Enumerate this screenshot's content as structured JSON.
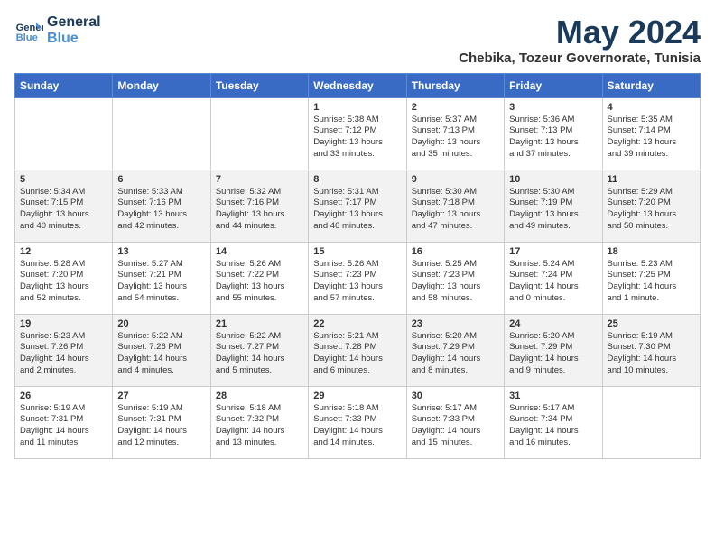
{
  "logo": {
    "line1": "General",
    "line2": "Blue"
  },
  "title": "May 2024",
  "location": "Chebika, Tozeur Governorate, Tunisia",
  "days_header": [
    "Sunday",
    "Monday",
    "Tuesday",
    "Wednesday",
    "Thursday",
    "Friday",
    "Saturday"
  ],
  "weeks": [
    {
      "alt": false,
      "days": [
        {
          "num": "",
          "info": ""
        },
        {
          "num": "",
          "info": ""
        },
        {
          "num": "",
          "info": ""
        },
        {
          "num": "1",
          "info": "Sunrise: 5:38 AM\nSunset: 7:12 PM\nDaylight: 13 hours\nand 33 minutes."
        },
        {
          "num": "2",
          "info": "Sunrise: 5:37 AM\nSunset: 7:13 PM\nDaylight: 13 hours\nand 35 minutes."
        },
        {
          "num": "3",
          "info": "Sunrise: 5:36 AM\nSunset: 7:13 PM\nDaylight: 13 hours\nand 37 minutes."
        },
        {
          "num": "4",
          "info": "Sunrise: 5:35 AM\nSunset: 7:14 PM\nDaylight: 13 hours\nand 39 minutes."
        }
      ]
    },
    {
      "alt": true,
      "days": [
        {
          "num": "5",
          "info": "Sunrise: 5:34 AM\nSunset: 7:15 PM\nDaylight: 13 hours\nand 40 minutes."
        },
        {
          "num": "6",
          "info": "Sunrise: 5:33 AM\nSunset: 7:16 PM\nDaylight: 13 hours\nand 42 minutes."
        },
        {
          "num": "7",
          "info": "Sunrise: 5:32 AM\nSunset: 7:16 PM\nDaylight: 13 hours\nand 44 minutes."
        },
        {
          "num": "8",
          "info": "Sunrise: 5:31 AM\nSunset: 7:17 PM\nDaylight: 13 hours\nand 46 minutes."
        },
        {
          "num": "9",
          "info": "Sunrise: 5:30 AM\nSunset: 7:18 PM\nDaylight: 13 hours\nand 47 minutes."
        },
        {
          "num": "10",
          "info": "Sunrise: 5:30 AM\nSunset: 7:19 PM\nDaylight: 13 hours\nand 49 minutes."
        },
        {
          "num": "11",
          "info": "Sunrise: 5:29 AM\nSunset: 7:20 PM\nDaylight: 13 hours\nand 50 minutes."
        }
      ]
    },
    {
      "alt": false,
      "days": [
        {
          "num": "12",
          "info": "Sunrise: 5:28 AM\nSunset: 7:20 PM\nDaylight: 13 hours\nand 52 minutes."
        },
        {
          "num": "13",
          "info": "Sunrise: 5:27 AM\nSunset: 7:21 PM\nDaylight: 13 hours\nand 54 minutes."
        },
        {
          "num": "14",
          "info": "Sunrise: 5:26 AM\nSunset: 7:22 PM\nDaylight: 13 hours\nand 55 minutes."
        },
        {
          "num": "15",
          "info": "Sunrise: 5:26 AM\nSunset: 7:23 PM\nDaylight: 13 hours\nand 57 minutes."
        },
        {
          "num": "16",
          "info": "Sunrise: 5:25 AM\nSunset: 7:23 PM\nDaylight: 13 hours\nand 58 minutes."
        },
        {
          "num": "17",
          "info": "Sunrise: 5:24 AM\nSunset: 7:24 PM\nDaylight: 14 hours\nand 0 minutes."
        },
        {
          "num": "18",
          "info": "Sunrise: 5:23 AM\nSunset: 7:25 PM\nDaylight: 14 hours\nand 1 minute."
        }
      ]
    },
    {
      "alt": true,
      "days": [
        {
          "num": "19",
          "info": "Sunrise: 5:23 AM\nSunset: 7:26 PM\nDaylight: 14 hours\nand 2 minutes."
        },
        {
          "num": "20",
          "info": "Sunrise: 5:22 AM\nSunset: 7:26 PM\nDaylight: 14 hours\nand 4 minutes."
        },
        {
          "num": "21",
          "info": "Sunrise: 5:22 AM\nSunset: 7:27 PM\nDaylight: 14 hours\nand 5 minutes."
        },
        {
          "num": "22",
          "info": "Sunrise: 5:21 AM\nSunset: 7:28 PM\nDaylight: 14 hours\nand 6 minutes."
        },
        {
          "num": "23",
          "info": "Sunrise: 5:20 AM\nSunset: 7:29 PM\nDaylight: 14 hours\nand 8 minutes."
        },
        {
          "num": "24",
          "info": "Sunrise: 5:20 AM\nSunset: 7:29 PM\nDaylight: 14 hours\nand 9 minutes."
        },
        {
          "num": "25",
          "info": "Sunrise: 5:19 AM\nSunset: 7:30 PM\nDaylight: 14 hours\nand 10 minutes."
        }
      ]
    },
    {
      "alt": false,
      "days": [
        {
          "num": "26",
          "info": "Sunrise: 5:19 AM\nSunset: 7:31 PM\nDaylight: 14 hours\nand 11 minutes."
        },
        {
          "num": "27",
          "info": "Sunrise: 5:19 AM\nSunset: 7:31 PM\nDaylight: 14 hours\nand 12 minutes."
        },
        {
          "num": "28",
          "info": "Sunrise: 5:18 AM\nSunset: 7:32 PM\nDaylight: 14 hours\nand 13 minutes."
        },
        {
          "num": "29",
          "info": "Sunrise: 5:18 AM\nSunset: 7:33 PM\nDaylight: 14 hours\nand 14 minutes."
        },
        {
          "num": "30",
          "info": "Sunrise: 5:17 AM\nSunset: 7:33 PM\nDaylight: 14 hours\nand 15 minutes."
        },
        {
          "num": "31",
          "info": "Sunrise: 5:17 AM\nSunset: 7:34 PM\nDaylight: 14 hours\nand 16 minutes."
        },
        {
          "num": "",
          "info": ""
        }
      ]
    }
  ]
}
